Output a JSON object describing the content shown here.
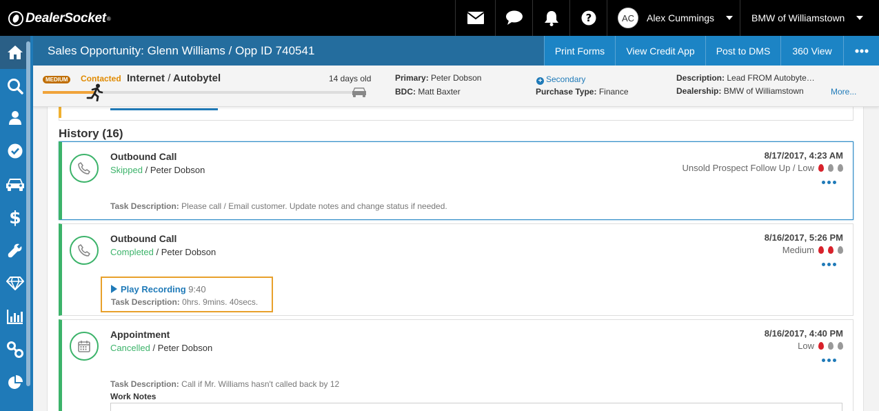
{
  "brand": {
    "name": "DealerSocket",
    "tm": "®"
  },
  "topnav": {
    "user_initials": "AC",
    "user_name": "Alex Cummings",
    "dealership": "BMW of Williamstown"
  },
  "titlebar": {
    "title": "Sales Opportunity: Glenn Williams / Opp ID 740541",
    "buttons": [
      "Print Forms",
      "View Credit App",
      "Post to DMS",
      "360 View"
    ]
  },
  "summary": {
    "priority_badge": "MEDIUM",
    "status": "Contacted",
    "source": "Internet",
    "source_sep": "/",
    "sub_source": "Autobytel",
    "age": "14 days old",
    "progress_fraction": 0.17,
    "primary_label": "Primary:",
    "primary_value": "Peter Dobson",
    "bdc_label": "BDC:",
    "bdc_value": "Matt Baxter",
    "secondary_link": "Secondary",
    "purchase_type_label": "Purchase Type:",
    "purchase_type_value": "Finance",
    "description_label": "Description:",
    "description_value": "Lead FROM Autobyte…",
    "dealership_label": "Dealership:",
    "dealership_value": "BMW of Williamstown",
    "more_link": "More..."
  },
  "history": {
    "heading": "History (16)",
    "items": [
      {
        "title": "Outbound Call",
        "status": "Skipped",
        "sep": "/",
        "owner": "Peter Dobson",
        "date": "8/17/2017, 4:23 AM",
        "meta": "Unsold Prospect Follow Up / Low",
        "desc_label": "Task Description:",
        "desc_value": "Please call / Email customer. Update notes and change status if needed.",
        "icon": "phone-icon",
        "flames_on": 1
      },
      {
        "title": "Outbound Call",
        "status": "Completed",
        "sep": "/",
        "owner": "Peter Dobson",
        "date": "8/16/2017, 5:26 PM",
        "meta": "Medium",
        "play_label": "Play Recording",
        "play_duration": "9:40",
        "desc_label": "Task Description:",
        "desc_value": "0hrs. 9mins. 40secs.",
        "icon": "phone-icon",
        "flames_on": 2
      },
      {
        "title": "Appointment",
        "status": "Cancelled",
        "sep": "/",
        "owner": "Peter Dobson",
        "date": "8/16/2017, 4:40 PM",
        "meta": "Low",
        "desc_label": "Task Description:",
        "desc_value": "Call if Mr. Williams hasn't called back by 12",
        "work_notes_label": "Work Notes",
        "icon": "calendar-icon",
        "flames_on": 1
      }
    ]
  },
  "colors": {
    "nav_bg": "#000000",
    "sidebar_bg": "#1f7ab8",
    "titlebar_bg": "#246d9e",
    "button_bg": "#1c84c5",
    "status_green": "#3cb36a",
    "contacted_orange": "#e08a00",
    "flame_red": "#d8222b"
  }
}
